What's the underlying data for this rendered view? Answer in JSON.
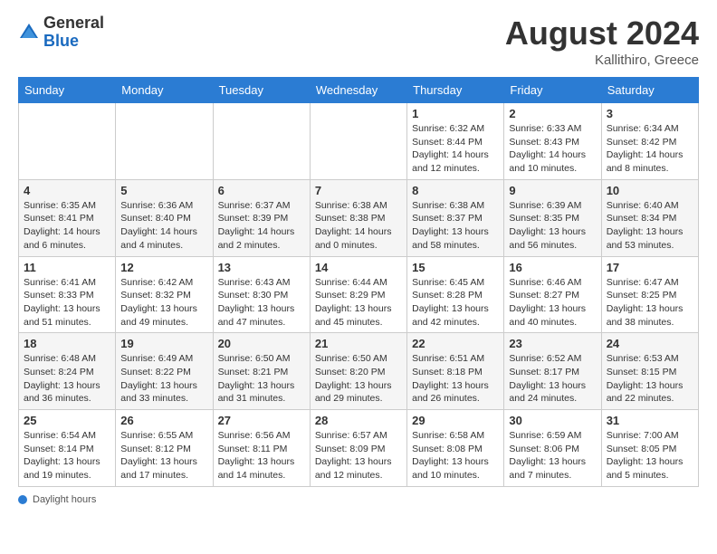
{
  "header": {
    "logo_general": "General",
    "logo_blue": "Blue",
    "month_year": "August 2024",
    "location": "Kallithiro, Greece"
  },
  "weekdays": [
    "Sunday",
    "Monday",
    "Tuesday",
    "Wednesday",
    "Thursday",
    "Friday",
    "Saturday"
  ],
  "weeks": [
    [
      {
        "day": "",
        "info": ""
      },
      {
        "day": "",
        "info": ""
      },
      {
        "day": "",
        "info": ""
      },
      {
        "day": "",
        "info": ""
      },
      {
        "day": "1",
        "info": "Sunrise: 6:32 AM\nSunset: 8:44 PM\nDaylight: 14 hours and 12 minutes."
      },
      {
        "day": "2",
        "info": "Sunrise: 6:33 AM\nSunset: 8:43 PM\nDaylight: 14 hours and 10 minutes."
      },
      {
        "day": "3",
        "info": "Sunrise: 6:34 AM\nSunset: 8:42 PM\nDaylight: 14 hours and 8 minutes."
      }
    ],
    [
      {
        "day": "4",
        "info": "Sunrise: 6:35 AM\nSunset: 8:41 PM\nDaylight: 14 hours and 6 minutes."
      },
      {
        "day": "5",
        "info": "Sunrise: 6:36 AM\nSunset: 8:40 PM\nDaylight: 14 hours and 4 minutes."
      },
      {
        "day": "6",
        "info": "Sunrise: 6:37 AM\nSunset: 8:39 PM\nDaylight: 14 hours and 2 minutes."
      },
      {
        "day": "7",
        "info": "Sunrise: 6:38 AM\nSunset: 8:38 PM\nDaylight: 14 hours and 0 minutes."
      },
      {
        "day": "8",
        "info": "Sunrise: 6:38 AM\nSunset: 8:37 PM\nDaylight: 13 hours and 58 minutes."
      },
      {
        "day": "9",
        "info": "Sunrise: 6:39 AM\nSunset: 8:35 PM\nDaylight: 13 hours and 56 minutes."
      },
      {
        "day": "10",
        "info": "Sunrise: 6:40 AM\nSunset: 8:34 PM\nDaylight: 13 hours and 53 minutes."
      }
    ],
    [
      {
        "day": "11",
        "info": "Sunrise: 6:41 AM\nSunset: 8:33 PM\nDaylight: 13 hours and 51 minutes."
      },
      {
        "day": "12",
        "info": "Sunrise: 6:42 AM\nSunset: 8:32 PM\nDaylight: 13 hours and 49 minutes."
      },
      {
        "day": "13",
        "info": "Sunrise: 6:43 AM\nSunset: 8:30 PM\nDaylight: 13 hours and 47 minutes."
      },
      {
        "day": "14",
        "info": "Sunrise: 6:44 AM\nSunset: 8:29 PM\nDaylight: 13 hours and 45 minutes."
      },
      {
        "day": "15",
        "info": "Sunrise: 6:45 AM\nSunset: 8:28 PM\nDaylight: 13 hours and 42 minutes."
      },
      {
        "day": "16",
        "info": "Sunrise: 6:46 AM\nSunset: 8:27 PM\nDaylight: 13 hours and 40 minutes."
      },
      {
        "day": "17",
        "info": "Sunrise: 6:47 AM\nSunset: 8:25 PM\nDaylight: 13 hours and 38 minutes."
      }
    ],
    [
      {
        "day": "18",
        "info": "Sunrise: 6:48 AM\nSunset: 8:24 PM\nDaylight: 13 hours and 36 minutes."
      },
      {
        "day": "19",
        "info": "Sunrise: 6:49 AM\nSunset: 8:22 PM\nDaylight: 13 hours and 33 minutes."
      },
      {
        "day": "20",
        "info": "Sunrise: 6:50 AM\nSunset: 8:21 PM\nDaylight: 13 hours and 31 minutes."
      },
      {
        "day": "21",
        "info": "Sunrise: 6:50 AM\nSunset: 8:20 PM\nDaylight: 13 hours and 29 minutes."
      },
      {
        "day": "22",
        "info": "Sunrise: 6:51 AM\nSunset: 8:18 PM\nDaylight: 13 hours and 26 minutes."
      },
      {
        "day": "23",
        "info": "Sunrise: 6:52 AM\nSunset: 8:17 PM\nDaylight: 13 hours and 24 minutes."
      },
      {
        "day": "24",
        "info": "Sunrise: 6:53 AM\nSunset: 8:15 PM\nDaylight: 13 hours and 22 minutes."
      }
    ],
    [
      {
        "day": "25",
        "info": "Sunrise: 6:54 AM\nSunset: 8:14 PM\nDaylight: 13 hours and 19 minutes."
      },
      {
        "day": "26",
        "info": "Sunrise: 6:55 AM\nSunset: 8:12 PM\nDaylight: 13 hours and 17 minutes."
      },
      {
        "day": "27",
        "info": "Sunrise: 6:56 AM\nSunset: 8:11 PM\nDaylight: 13 hours and 14 minutes."
      },
      {
        "day": "28",
        "info": "Sunrise: 6:57 AM\nSunset: 8:09 PM\nDaylight: 13 hours and 12 minutes."
      },
      {
        "day": "29",
        "info": "Sunrise: 6:58 AM\nSunset: 8:08 PM\nDaylight: 13 hours and 10 minutes."
      },
      {
        "day": "30",
        "info": "Sunrise: 6:59 AM\nSunset: 8:06 PM\nDaylight: 13 hours and 7 minutes."
      },
      {
        "day": "31",
        "info": "Sunrise: 7:00 AM\nSunset: 8:05 PM\nDaylight: 13 hours and 5 minutes."
      }
    ]
  ],
  "legend": {
    "label": "Daylight hours"
  }
}
